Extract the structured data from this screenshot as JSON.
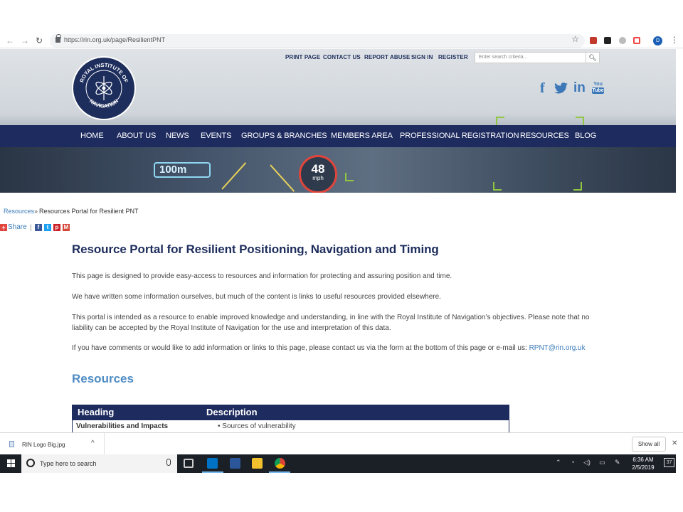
{
  "browser": {
    "url": "https://rin.org.uk/page/ResilientPNT",
    "avatar_letter": "D"
  },
  "site": {
    "utility_links": [
      "PRINT PAGE",
      "CONTACT US",
      "REPORT ABUSE",
      "SIGN IN",
      "REGISTER"
    ],
    "search_placeholder": "Enter search criteria...",
    "logo_text_top": "ROYAL INSTITUTE OF",
    "logo_text_bottom": "NAVIGATION",
    "social": [
      "facebook-icon",
      "twitter-icon",
      "linkedin-icon",
      "youtube-icon"
    ],
    "social_glyphs": {
      "facebook": "f",
      "linkedin": "in",
      "youtube_top": "You",
      "youtube_bottom": "Tube"
    },
    "nav": [
      "HOME",
      "ABOUT US",
      "NEWS",
      "EVENTS",
      "GROUPS & BRANCHES",
      "MEMBERS AREA",
      "PROFESSIONAL REGISTRATION",
      "RESOURCES",
      "BLOG"
    ],
    "hud": {
      "distance": "100m",
      "speed": "48",
      "speed_unit": "mph"
    },
    "colors": {
      "navy": "#1e2b5f",
      "link": "#3a7ab8",
      "heading_blue": "#4f8cc4"
    }
  },
  "breadcrumb": {
    "link": "Resources",
    "separator": "»",
    "current": "Resources Portal for Resilient PNT"
  },
  "share": {
    "label": "Share",
    "separator": "|",
    "buttons": [
      "facebook-share",
      "twitter-share",
      "pinterest-share",
      "gmail-share"
    ],
    "glyphs": [
      "f",
      "t",
      "p",
      "M"
    ]
  },
  "content": {
    "title": "Resource Portal for Resilient Positioning, Navigation and Timing",
    "p1": "This page is designed to provide easy-access to resources and information for protecting and assuring position and time.",
    "p2": "We have written some information ourselves, but much of the content is links to useful resources provided elsewhere.",
    "p3": "This portal is intended as a resource to enable improved knowledge and understanding, in line with the Royal Institute of Navigation’s objectives. Please note that no liability can be accepted by the Royal Institute of Navigation for the use and interpretation of this data.",
    "p4": "If you have comments or would like to add information or links to this page, please contact us via the form at the bottom of this page or e-mail us:",
    "email": "RPNT@rin.org.uk",
    "resources_heading": "Resources",
    "table": {
      "headers": [
        "Heading",
        "Description"
      ],
      "rows": [
        {
          "heading": "Vulnerabilities and Impacts",
          "description": "• Sources of vulnerability"
        }
      ]
    }
  },
  "downloads": {
    "file": "RIN Logo Big.jpg",
    "show_all": "Show all"
  },
  "taskbar": {
    "search_placeholder": "Type here to search",
    "time": "6:36 AM",
    "date": "2/5/2019",
    "notification_count": "37"
  }
}
